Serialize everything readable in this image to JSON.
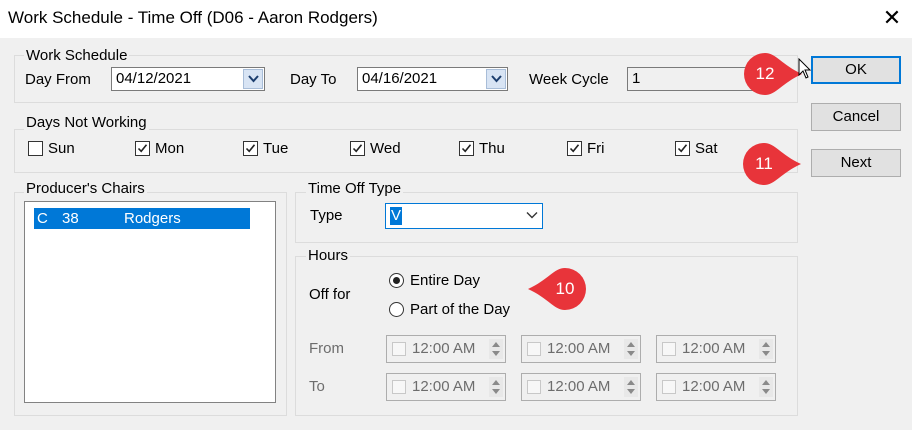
{
  "window": {
    "title": "Work Schedule - Time Off (D06 - Aaron Rodgers)"
  },
  "work_schedule": {
    "legend": "Work Schedule",
    "day_from_label": "Day From",
    "day_from_value": "04/12/2021",
    "day_to_label": "Day To",
    "day_to_value": "04/16/2021",
    "week_cycle_label": "Week Cycle",
    "week_cycle_value": "1"
  },
  "days_not_working": {
    "legend": "Days Not Working",
    "days": [
      {
        "label": "Sun",
        "checked": false
      },
      {
        "label": "Mon",
        "checked": true
      },
      {
        "label": "Tue",
        "checked": true
      },
      {
        "label": "Wed",
        "checked": true
      },
      {
        "label": "Thu",
        "checked": true
      },
      {
        "label": "Fri",
        "checked": true
      },
      {
        "label": "Sat",
        "checked": true
      }
    ]
  },
  "producers_chairs": {
    "legend": "Producer's Chairs",
    "selected": {
      "type": "C",
      "number": "38",
      "name": "Rodgers"
    }
  },
  "time_off_type": {
    "legend": "Time Off Type",
    "type_label": "Type",
    "type_value": "V"
  },
  "hours": {
    "legend": "Hours",
    "off_for_label": "Off for",
    "entire_day_label": "Entire Day",
    "part_day_label": "Part of the Day",
    "selected": "entire_day",
    "from_label": "From",
    "to_label": "To",
    "times": [
      "12:00 AM",
      "12:00 AM",
      "12:00 AM",
      "12:00 AM",
      "12:00 AM",
      "12:00 AM"
    ]
  },
  "buttons": {
    "ok": "OK",
    "cancel": "Cancel",
    "next": "Next"
  },
  "callouts": [
    "12",
    "11",
    "10"
  ],
  "colors": {
    "selection": "#0078d7",
    "callout": "#e8343a",
    "window_bg": "#f0f0f0"
  },
  "icons": {
    "close": "close-icon",
    "dropdown": "chevron-down-icon",
    "spin": "spin-updown-icon"
  }
}
